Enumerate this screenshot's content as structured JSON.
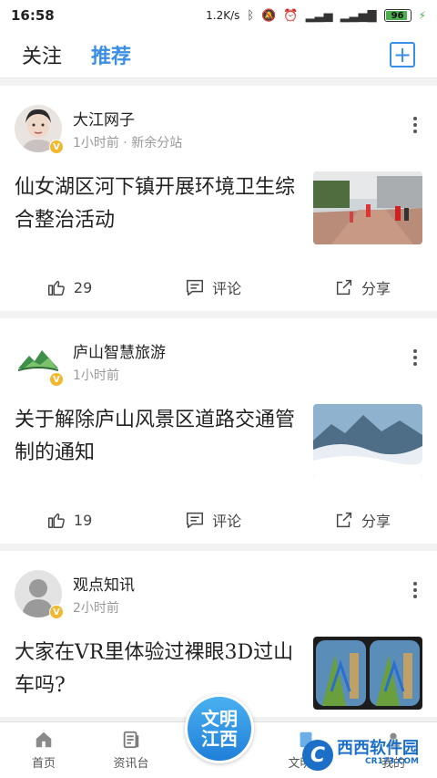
{
  "status_bar": {
    "time": "16:58",
    "net_speed": "1.2K/s",
    "battery": "96"
  },
  "header": {
    "tabs": [
      {
        "label": "关注"
      },
      {
        "label": "推荐"
      }
    ],
    "add_symbol": "+"
  },
  "feed": [
    {
      "author": "大江网子",
      "meta": "1小时前 · 新余分站",
      "title": "仙女湖区河下镇开展环境卫生综合整治活动",
      "likes": "29",
      "comment_label": "评论",
      "share_label": "分享",
      "verified_badge": "V"
    },
    {
      "author": "庐山智慧旅游",
      "meta": "1小时前",
      "title": "关于解除庐山风景区道路交通管制的通知",
      "likes": "19",
      "comment_label": "评论",
      "share_label": "分享",
      "verified_badge": "V"
    },
    {
      "author": "观点知讯",
      "meta": "2小时前",
      "title": "大家在VR里体验过裸眼3D过山车吗?",
      "verified_badge": "V"
    }
  ],
  "bottom_nav": {
    "items": [
      {
        "label": "首页"
      },
      {
        "label": "资讯台"
      },
      {
        "label": "文明号"
      },
      {
        "label": "我的"
      }
    ],
    "center_line1": "文明",
    "center_line2": "江西"
  },
  "watermark": {
    "main": "西西软件园",
    "sub": "CR173.COM"
  },
  "colors": {
    "accent": "#3a8ee6",
    "badge": "#f2b72d"
  }
}
